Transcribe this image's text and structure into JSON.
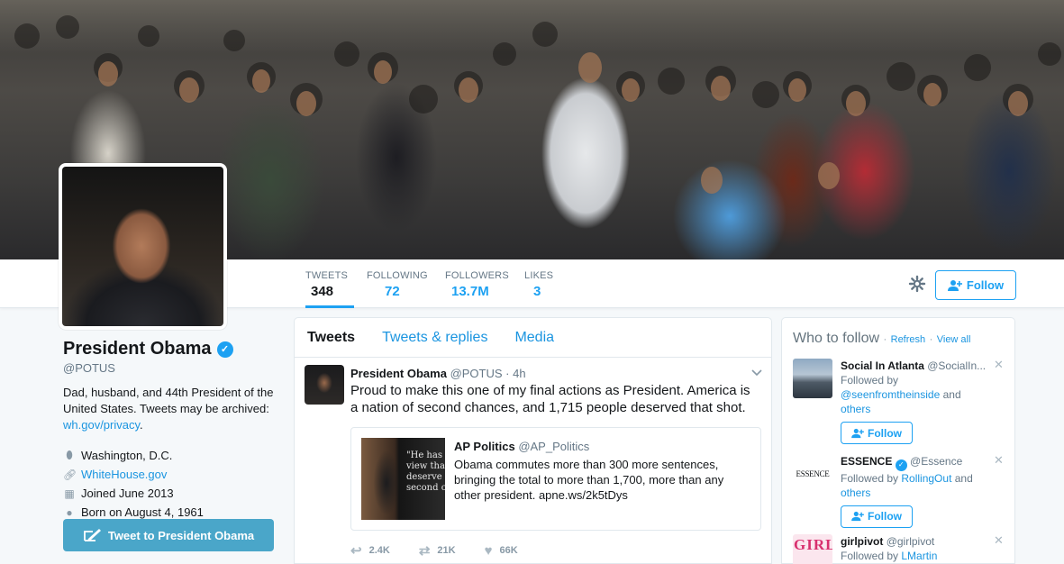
{
  "profile": {
    "name": "President Obama",
    "handle": "@POTUS",
    "bio_text": "Dad, husband, and 44th President of the United States. Tweets may be archived:",
    "bio_link": "wh.gov/privacy",
    "location": "Washington, D.C.",
    "website": "WhiteHouse.gov",
    "joined": "Joined June 2013",
    "born": "Born on August 4, 1961",
    "tweet_to_label": "Tweet to President Obama"
  },
  "stats": [
    {
      "label": "TWEETS",
      "value": "348"
    },
    {
      "label": "FOLLOWING",
      "value": "72"
    },
    {
      "label": "FOLLOWERS",
      "value": "13.7M"
    },
    {
      "label": "LIKES",
      "value": "3"
    }
  ],
  "follow_label": "Follow",
  "timeline": {
    "tabs": [
      "Tweets",
      "Tweets & replies",
      "Media"
    ],
    "tweet": {
      "name": "President Obama",
      "handle": "@POTUS",
      "time": "· 4h",
      "text": "Proud to make this one of my final actions as President. America is a nation of second chances, and 1,715 people deserved that shot.",
      "quote": {
        "name": "AP Politics",
        "handle": "@AP_Politics",
        "text": "Obama commutes more than 300 more sentences, bringing the total to more than 1,700, more than any other president. apne.ws/2k5tDys"
      },
      "actions": {
        "replies_label": "",
        "retweets": "2.4K",
        "retweets2": "21K",
        "likes": "66K"
      }
    }
  },
  "who_to_follow": {
    "title": "Who to follow",
    "refresh": "Refresh",
    "view_all": "View all",
    "suggestions": [
      {
        "name": "Social In Atlanta",
        "handle": "@SocialIn...",
        "followed_prefix": "Followed by",
        "followed_by": "@seenfromtheinside",
        "and": "and",
        "others": "others",
        "button": "Follow"
      },
      {
        "name": "ESSENCE",
        "handle": "@Essence",
        "followed_prefix": "Followed by",
        "followed_by": "RollingOut",
        "and": "and",
        "others": "others",
        "button": "Follow",
        "avatar_text": "ESSENCE"
      },
      {
        "name": "girlpivot",
        "handle": "@girlpivot",
        "followed_prefix": "Followed by",
        "followed_by": "LMartin",
        "avatar_text": "GIRL"
      }
    ]
  },
  "colors": {
    "accent": "#1da1f2",
    "link": "#1b95e0",
    "tweet_to_bg": "#4aa6c9"
  }
}
